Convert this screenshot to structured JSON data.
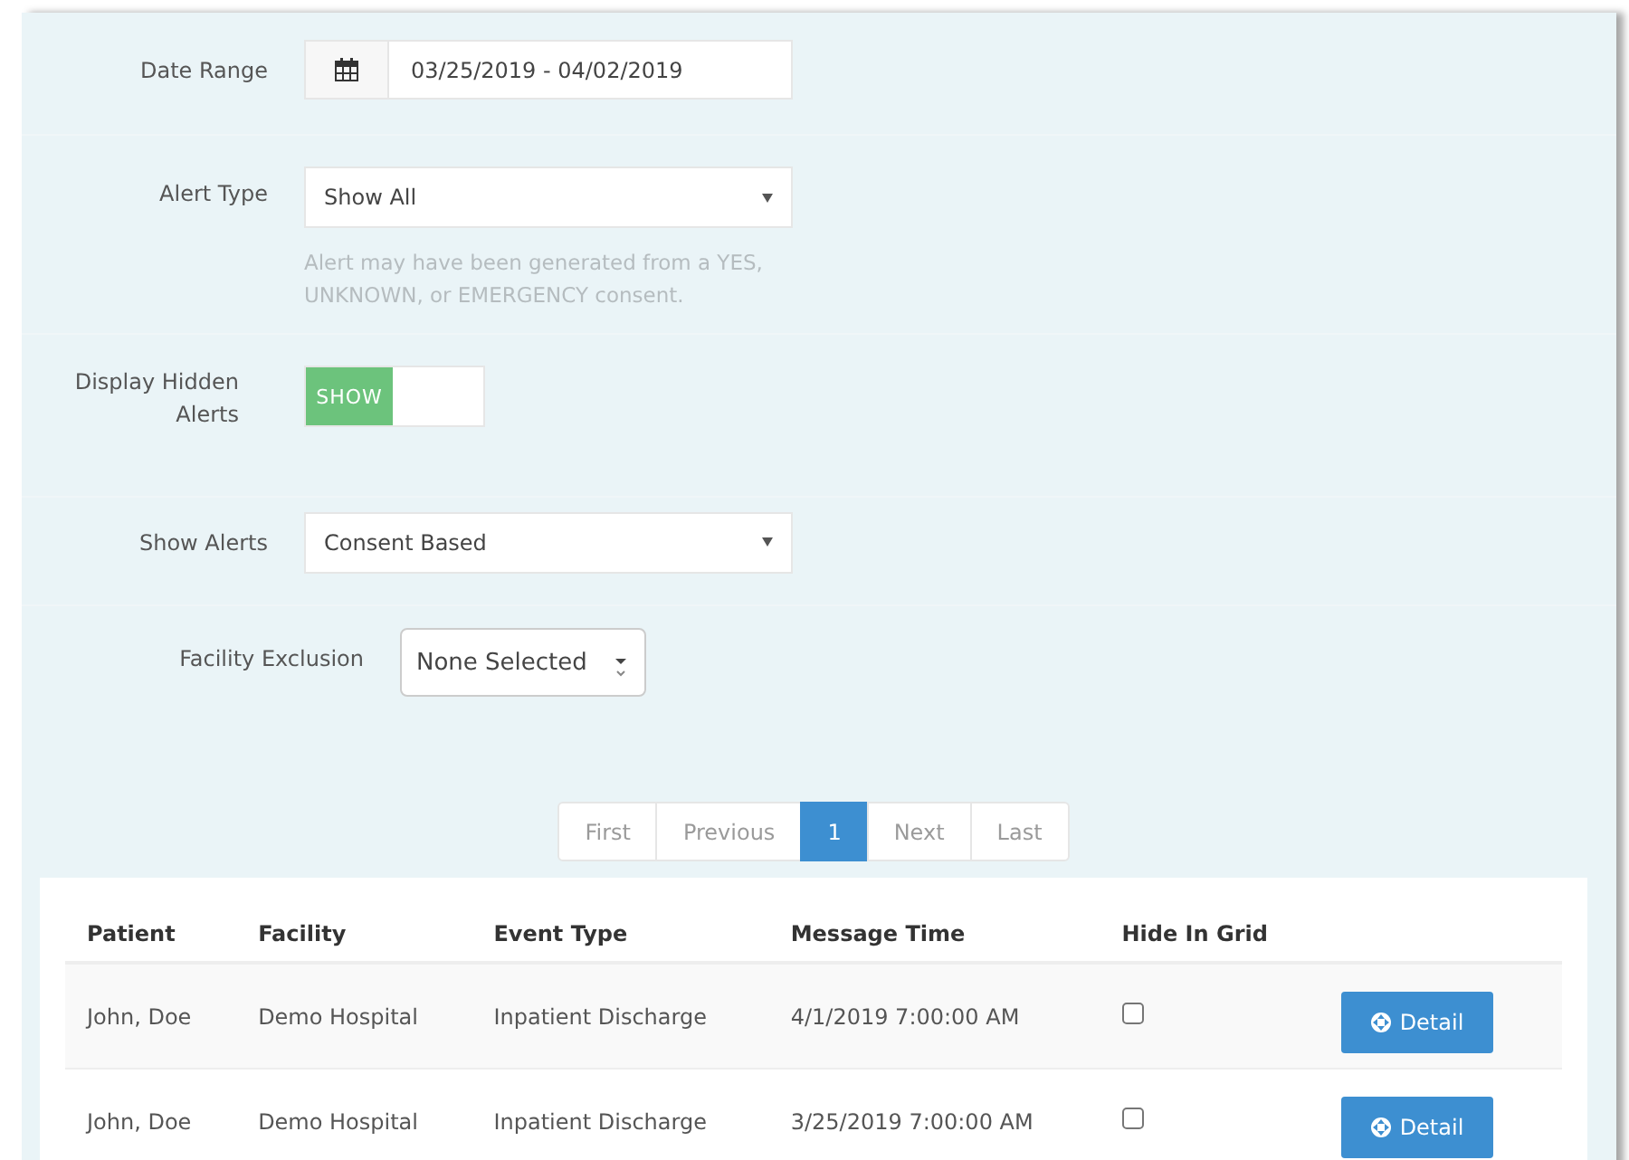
{
  "filters": {
    "date_range": {
      "label": "Date Range",
      "value": "03/25/2019 - 04/02/2019"
    },
    "alert_type": {
      "label": "Alert Type",
      "value": "Show All",
      "help": "Alert may have been generated from a YES, UNKNOWN, or EMERGENCY consent."
    },
    "display_hidden": {
      "label": "Display Hidden Alerts",
      "switch_label": "SHOW",
      "on": true
    },
    "show_alerts": {
      "label": "Show Alerts",
      "value": "Consent Based"
    },
    "facility_exclusion": {
      "label": "Facility Exclusion",
      "value": "None Selected"
    }
  },
  "pagination": [
    {
      "label": "First",
      "selected": false,
      "disabled": true
    },
    {
      "label": "Previous",
      "selected": false,
      "disabled": true
    },
    {
      "label": "1",
      "selected": true,
      "disabled": false
    },
    {
      "label": "Next",
      "selected": false,
      "disabled": true
    },
    {
      "label": "Last",
      "selected": false,
      "disabled": true
    }
  ],
  "table": {
    "columns": [
      "Patient",
      "Facility",
      "Event Type",
      "Message Time",
      "Hide In Grid"
    ],
    "rows": [
      {
        "patient": "John, Doe",
        "facility": "Demo Hospital",
        "event_type": "Inpatient Discharge",
        "message_time": "4/1/2019 7:00:00 AM",
        "hidden": false,
        "action": "Detail"
      },
      {
        "patient": "John, Doe",
        "facility": "Demo Hospital",
        "event_type": "Inpatient Discharge",
        "message_time": "3/25/2019 7:00:00 AM",
        "hidden": false,
        "action": "Detail"
      }
    ]
  }
}
